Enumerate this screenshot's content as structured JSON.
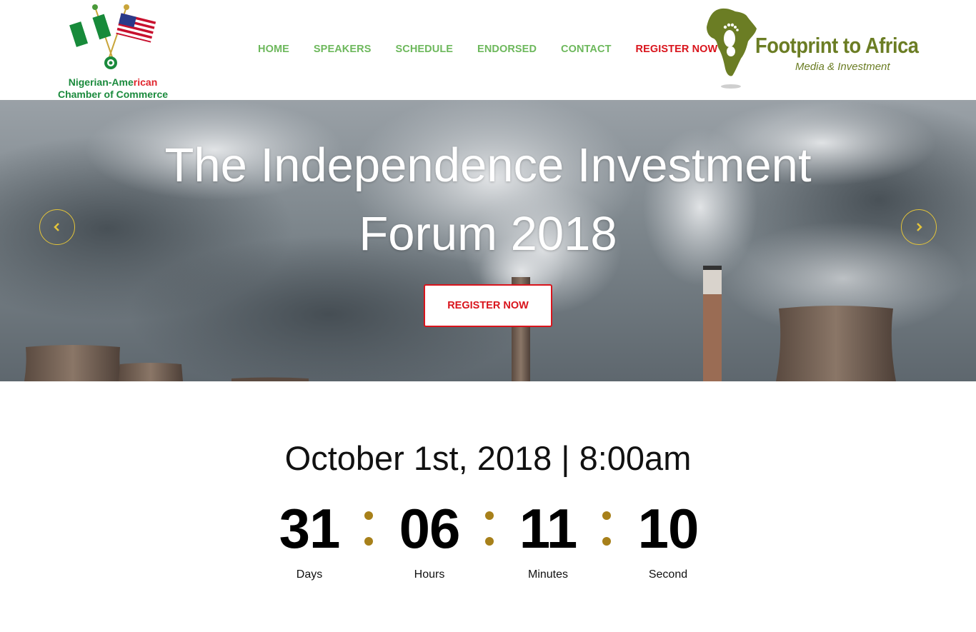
{
  "logo_left": {
    "line1_a": "Nigerian-Ame",
    "line1_b": "rican",
    "line2": "Chamber of Commerce"
  },
  "nav": {
    "items": [
      "HOME",
      "SPEAKERS",
      "SCHEDULE",
      "ENDORSED",
      "CONTACT"
    ],
    "register": "REGISTER NOW"
  },
  "logo_right": {
    "brand": "Footprint to Africa",
    "tagline": "Media & Investment"
  },
  "hero": {
    "title_line1": "The Independence Investment",
    "title_line2": "Forum 2018",
    "button": "REGISTER NOW"
  },
  "event": {
    "date": "October 1st, 2018 | 8:00am"
  },
  "countdown": {
    "days": "31",
    "days_label": "Days",
    "hours": "06",
    "hours_label": "Hours",
    "minutes": "11",
    "minutes_label": "Minutes",
    "seconds": "10",
    "seconds_label": "Second"
  },
  "colors": {
    "nav_green": "#6db85c",
    "accent_red": "#d9141c",
    "arrow_gold": "#e3c43a",
    "colon_gold": "#a7801a",
    "brand_olive": "#6b7d24"
  }
}
